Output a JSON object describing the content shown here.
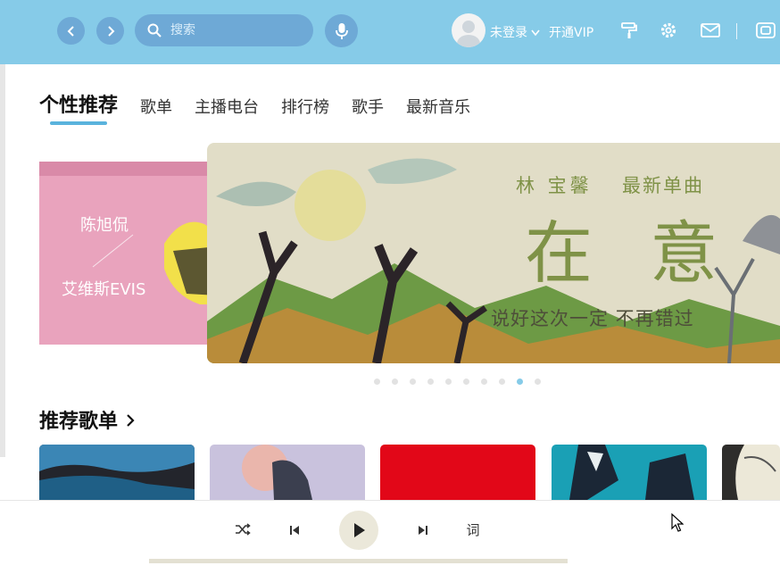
{
  "header": {
    "search_placeholder": "搜索",
    "login_label": "未登录",
    "vip_label": "开通VIP",
    "icons": [
      "back-icon",
      "forward-icon",
      "search-icon",
      "microphone-icon",
      "skin-icon",
      "settings-icon",
      "mail-icon",
      "mini-mode-icon"
    ]
  },
  "tabs": [
    "个性推荐",
    "歌单",
    "主播电台",
    "排行榜",
    "歌手",
    "最新音乐"
  ],
  "banner": {
    "left_slide": {
      "artist1": "陈旭侃",
      "artist2": "艾维斯EVIS"
    },
    "main_slide": {
      "singer": "林 宝馨",
      "tag": "最新单曲",
      "song": "在 意",
      "tagline": "说好这次一定 不再错过"
    },
    "dot_count": 10,
    "active_dot": 8
  },
  "recommend": {
    "title": "推荐歌单",
    "card_colors": [
      "#2f6f96",
      "#c9c2dd",
      "#e20718",
      "#1aa0b5",
      "#ece8d8"
    ]
  },
  "player": {
    "lyric_label": "词",
    "icons": [
      "shuffle-icon",
      "previous-icon",
      "play-icon",
      "next-icon"
    ]
  },
  "colors": {
    "accent": "#86cbe8",
    "button": "#6ea9d6"
  }
}
